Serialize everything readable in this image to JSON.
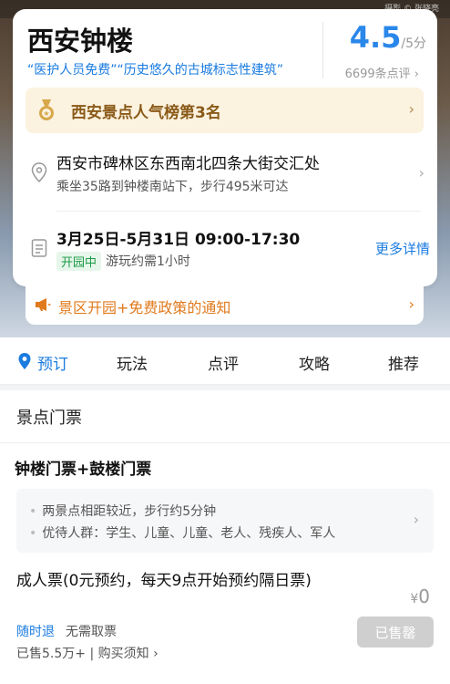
{
  "hero": {
    "photo_caption": "摄影 © 张晓亮"
  },
  "attraction": {
    "name": "西安钟楼",
    "tags": "“医护人员免费”“历史悠久的古城标志性建筑”",
    "rating": "4.5",
    "rating_max": "/5分",
    "review_count": "6699条点评",
    "ranking": "西安景点人气榜第3名",
    "address": "西安市碑林区东西南北四条大街交汇处",
    "transit": "乘坐35路到钟楼南站下，步行495米可达",
    "hours": "3月25日-5月31日 09:00-17:30",
    "status": "开园中",
    "duration": "游玩约需1小时",
    "more_details": "更多详情"
  },
  "notice": {
    "text": "景区开园+免费政策的通知"
  },
  "tabs": [
    {
      "label": "预订"
    },
    {
      "label": "玩法"
    },
    {
      "label": "点评"
    },
    {
      "label": "攻略"
    },
    {
      "label": "推荐"
    }
  ],
  "tickets": {
    "section_title": "景点门票",
    "package_title": "钟楼门票+鼓楼门票",
    "notes": [
      "两景点相距较近，步行约5分钟",
      "优待人群：学生、儿童、儿童、老人、残疾人、军人"
    ],
    "item": {
      "name": "成人票(0元预约，每天9点开始预约隔日票)",
      "currency": "¥",
      "price": "0",
      "refund": "随时退",
      "pickup": "无需取票",
      "sold": "已售5.5万+ | 购买须知",
      "button": "已售罄"
    }
  },
  "colors": {
    "accent": "#1a7be0",
    "status_green": "#1c9a46",
    "notice_orange": "#e07a1c",
    "rank_brown": "#8a5a18"
  },
  "icons": [
    "medal-icon",
    "location-icon",
    "document-icon",
    "megaphone-icon",
    "pin-icon",
    "chevron-right-icon"
  ]
}
